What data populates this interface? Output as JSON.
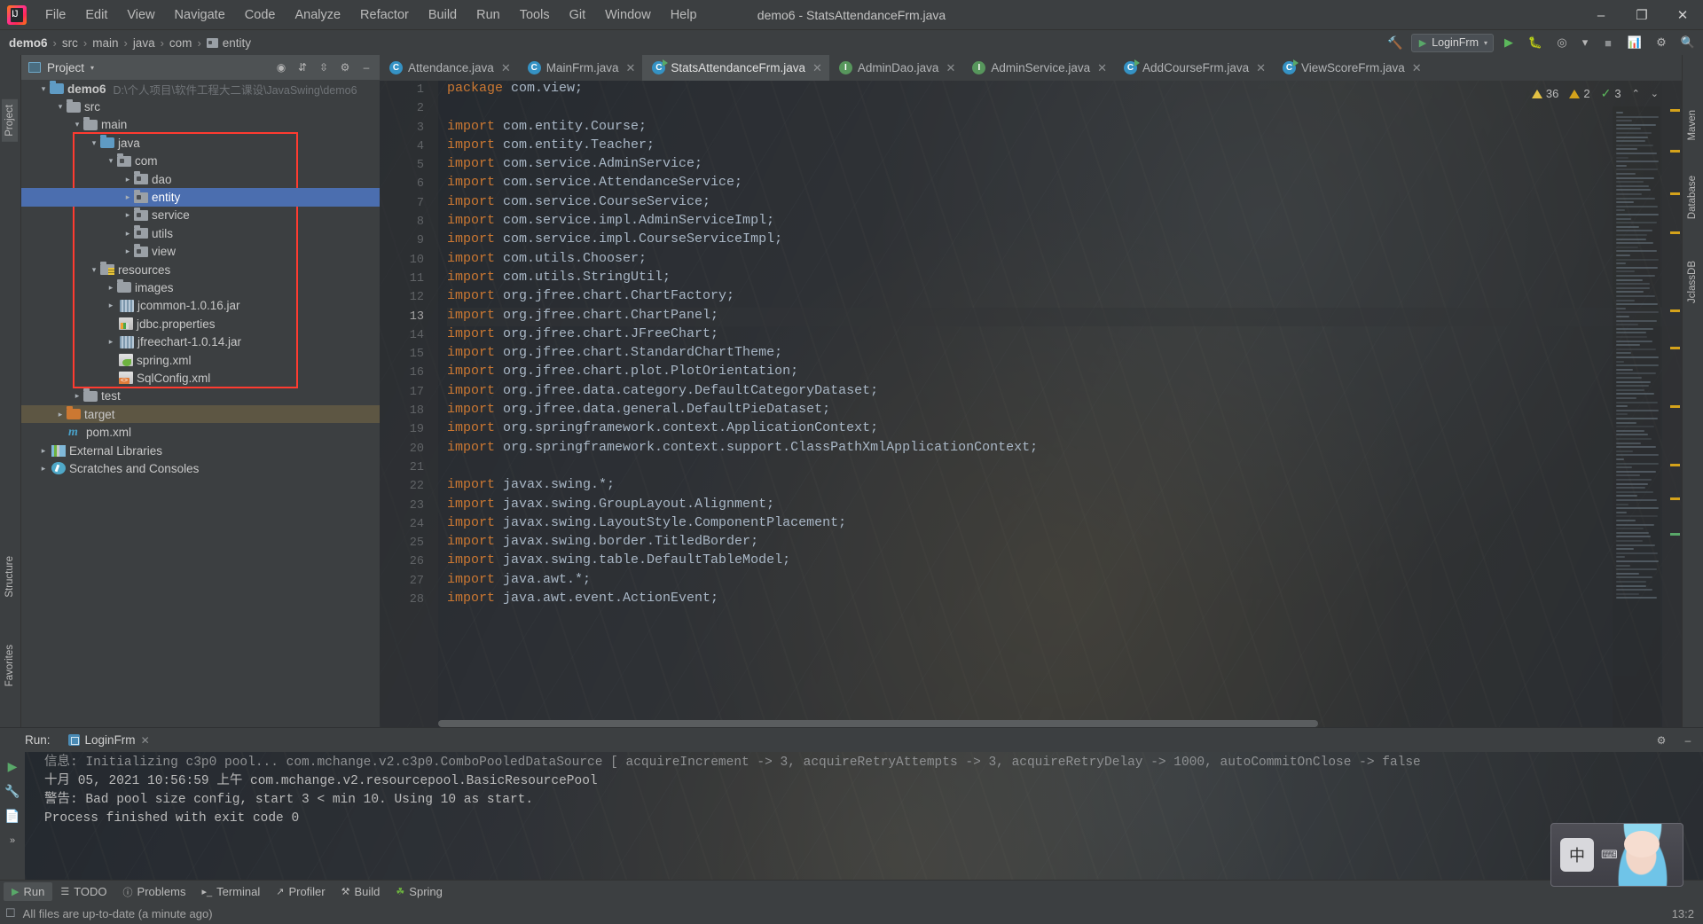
{
  "window": {
    "title": "demo6 - StatsAttendanceFrm.java",
    "controls": {
      "minimize": "–",
      "maximize": "❐",
      "close": "✕"
    }
  },
  "menubar": [
    "File",
    "Edit",
    "View",
    "Navigate",
    "Code",
    "Analyze",
    "Refactor",
    "Build",
    "Run",
    "Tools",
    "Git",
    "Window",
    "Help"
  ],
  "breadcrumb": {
    "items": [
      "demo6",
      "src",
      "main",
      "java",
      "com",
      "entity"
    ],
    "separator": "›"
  },
  "toolbar": {
    "hammer_icon": "hammer-icon",
    "run_config": "LoginFrm",
    "run_config_caret": "▾",
    "run_button": "▶",
    "debug_button": "debug-icon",
    "coverage_button": "coverage-icon",
    "profile_caret": "▾",
    "stop_button": "■",
    "search_button": "search-icon",
    "updates_button": "updates-icon"
  },
  "left_strip": {
    "tabs": [
      "Project",
      "Structure",
      "Favorites"
    ]
  },
  "right_strip": {
    "tabs": [
      "Maven",
      "Database",
      "JclassDB"
    ]
  },
  "project_panel": {
    "title": "Project",
    "caret": "▾",
    "buttons": [
      "locate-icon",
      "expand-all-icon",
      "collapse-all-icon",
      "settings-icon",
      "hide-icon"
    ],
    "tree": [
      {
        "label": "demo6",
        "sub": "D:\\个人项目\\软件工程大二课设\\JavaSwing\\demo6",
        "indent": 0,
        "arrow": "down",
        "icon": "module-folder",
        "bold": true,
        "state": "normal"
      },
      {
        "label": "src",
        "indent": 1,
        "arrow": "down",
        "icon": "folder",
        "state": "normal"
      },
      {
        "label": "main",
        "indent": 2,
        "arrow": "down",
        "icon": "folder",
        "state": "normal"
      },
      {
        "label": "java",
        "indent": 3,
        "arrow": "down",
        "icon": "source-folder",
        "state": "normal"
      },
      {
        "label": "com",
        "indent": 4,
        "arrow": "down",
        "icon": "package",
        "state": "normal"
      },
      {
        "label": "dao",
        "indent": 5,
        "arrow": "right",
        "icon": "package",
        "state": "normal"
      },
      {
        "label": "entity",
        "indent": 5,
        "arrow": "right",
        "icon": "package",
        "state": "selected"
      },
      {
        "label": "service",
        "indent": 5,
        "arrow": "right",
        "icon": "package",
        "state": "normal"
      },
      {
        "label": "utils",
        "indent": 5,
        "arrow": "right",
        "icon": "package",
        "state": "normal"
      },
      {
        "label": "view",
        "indent": 5,
        "arrow": "right",
        "icon": "package",
        "state": "normal"
      },
      {
        "label": "resources",
        "indent": 3,
        "arrow": "down",
        "icon": "resource-folder",
        "state": "normal"
      },
      {
        "label": "images",
        "indent": 4,
        "arrow": "right",
        "icon": "folder",
        "state": "normal"
      },
      {
        "label": "jcommon-1.0.16.jar",
        "indent": 4,
        "arrow": "right",
        "icon": "jar",
        "state": "normal"
      },
      {
        "label": "jdbc.properties",
        "indent": 4,
        "arrow": "none",
        "icon": "properties",
        "state": "normal"
      },
      {
        "label": "jfreechart-1.0.14.jar",
        "indent": 4,
        "arrow": "right",
        "icon": "jar",
        "state": "normal"
      },
      {
        "label": "spring.xml",
        "indent": 4,
        "arrow": "none",
        "icon": "spring-xml",
        "state": "normal"
      },
      {
        "label": "SqlConfig.xml",
        "indent": 4,
        "arrow": "none",
        "icon": "xml",
        "state": "normal"
      },
      {
        "label": "test",
        "indent": 2,
        "arrow": "right",
        "icon": "folder",
        "state": "normal"
      },
      {
        "label": "target",
        "indent": 1,
        "arrow": "right",
        "icon": "target-folder",
        "state": "highlight"
      },
      {
        "label": "pom.xml",
        "indent": 1,
        "arrow": "none",
        "icon": "maven",
        "state": "normal"
      },
      {
        "label": "External Libraries",
        "indent": 0,
        "arrow": "right",
        "icon": "libraries",
        "state": "normal"
      },
      {
        "label": "Scratches and Consoles",
        "indent": 0,
        "arrow": "right",
        "icon": "scratches",
        "state": "normal"
      }
    ]
  },
  "editor": {
    "tabs": [
      {
        "label": "Attendance.java",
        "icon": "class-icon",
        "active": false,
        "close": "✕"
      },
      {
        "label": "MainFrm.java",
        "icon": "class-icon",
        "active": false,
        "close": "✕"
      },
      {
        "label": "StatsAttendanceFrm.java",
        "icon": "runnable-class-icon",
        "active": true,
        "close": "✕"
      },
      {
        "label": "AdminDao.java",
        "icon": "interface-icon",
        "active": false,
        "close": "✕"
      },
      {
        "label": "AdminService.java",
        "icon": "interface-icon",
        "active": false,
        "close": "✕"
      },
      {
        "label": "AddCourseFrm.java",
        "icon": "runnable-class-icon",
        "active": false,
        "close": "✕"
      },
      {
        "label": "ViewScoreFrm.java",
        "icon": "runnable-class-icon",
        "active": false,
        "close": "✕"
      }
    ],
    "inspection": {
      "warnings": "36",
      "weak_warnings": "2",
      "ok_marks": "3",
      "up_caret": "⌃",
      "down_caret": "⌄"
    },
    "current_line": 13,
    "lines": [
      {
        "n": 1,
        "kw": "package",
        "rest": " com.view;"
      },
      {
        "n": 2,
        "kw": "",
        "rest": ""
      },
      {
        "n": 3,
        "kw": "import",
        "rest": " com.entity.Course;",
        "fold": true
      },
      {
        "n": 4,
        "kw": "import",
        "rest": " com.entity.Teacher;"
      },
      {
        "n": 5,
        "kw": "import",
        "rest": " com.service.AdminService;"
      },
      {
        "n": 6,
        "kw": "import",
        "rest": " com.service.AttendanceService;"
      },
      {
        "n": 7,
        "kw": "import",
        "rest": " com.service.CourseService;"
      },
      {
        "n": 8,
        "kw": "import",
        "rest": " com.service.impl.AdminServiceImpl;"
      },
      {
        "n": 9,
        "kw": "import",
        "rest": " com.service.impl.CourseServiceImpl;"
      },
      {
        "n": 10,
        "kw": "import",
        "rest": " com.utils.Chooser;"
      },
      {
        "n": 11,
        "kw": "import",
        "rest": " com.utils.StringUtil;"
      },
      {
        "n": 12,
        "kw": "import",
        "rest": " org.jfree.chart.ChartFactory;"
      },
      {
        "n": 13,
        "kw": "import",
        "rest": " org.jfree.chart.ChartPanel;"
      },
      {
        "n": 14,
        "kw": "import",
        "rest": " org.jfree.chart.JFreeChart;"
      },
      {
        "n": 15,
        "kw": "import",
        "rest": " org.jfree.chart.StandardChartTheme;"
      },
      {
        "n": 16,
        "kw": "import",
        "rest": " org.jfree.chart.plot.PlotOrientation;"
      },
      {
        "n": 17,
        "kw": "import",
        "rest": " org.jfree.data.category.DefaultCategoryDataset;"
      },
      {
        "n": 18,
        "kw": "import",
        "rest": " org.jfree.data.general.DefaultPieDataset;"
      },
      {
        "n": 19,
        "kw": "import",
        "rest": " org.springframework.context.ApplicationContext;"
      },
      {
        "n": 20,
        "kw": "import",
        "rest": " org.springframework.context.support.ClassPathXmlApplicationContext;"
      },
      {
        "n": 21,
        "kw": "",
        "rest": ""
      },
      {
        "n": 22,
        "kw": "import",
        "rest": " javax.swing.*;"
      },
      {
        "n": 23,
        "kw": "import",
        "rest": " javax.swing.GroupLayout.Alignment;"
      },
      {
        "n": 24,
        "kw": "import",
        "rest": " javax.swing.LayoutStyle.ComponentPlacement;"
      },
      {
        "n": 25,
        "kw": "import",
        "rest": " javax.swing.border.TitledBorder;"
      },
      {
        "n": 26,
        "kw": "import",
        "rest": " javax.swing.table.DefaultTableModel;"
      },
      {
        "n": 27,
        "kw": "import",
        "rest": " java.awt.*;"
      },
      {
        "n": 28,
        "kw": "import",
        "rest": " java.awt.event.ActionEvent;"
      }
    ]
  },
  "run_panel": {
    "label": "Run:",
    "tab": "LoginFrm",
    "tab_close": "✕",
    "settings_icon": "gear-icon",
    "hide_icon": "–",
    "side_buttons": [
      "rerun-icon",
      "settings-icon",
      "print-icon"
    ],
    "console": [
      "信息: Initializing c3p0 pool... com.mchange.v2.c3p0.ComboPooledDataSource [ acquireIncrement -> 3, acquireRetryAttempts -> 3, acquireRetryDelay -> 1000, autoCommitOnClose -> false",
      "十月 05, 2021 10:56:59 上午 com.mchange.v2.resourcepool.BasicResourcePool",
      "警告: Bad pool size config, start 3 < min 10. Using 10 as start.",
      "",
      "Process finished with exit code 0"
    ]
  },
  "bottom_bar": {
    "items": [
      {
        "label": "Run",
        "icon": "▶",
        "selected": true
      },
      {
        "label": "TODO",
        "icon": "todo-icon",
        "selected": false
      },
      {
        "label": "Problems",
        "icon": "problems-icon",
        "selected": false
      },
      {
        "label": "Terminal",
        "icon": "terminal-icon",
        "selected": false
      },
      {
        "label": "Profiler",
        "icon": "profiler-icon",
        "selected": false
      },
      {
        "label": "Build",
        "icon": "build-icon",
        "selected": false
      },
      {
        "label": "Spring",
        "icon": "spring-icon",
        "selected": false
      }
    ]
  },
  "status_bar": {
    "message": "All files are up-to-date (a minute ago)",
    "caret_position": "13:2",
    "event_icon": "event-log-icon"
  },
  "ime_widget": {
    "mode": "中",
    "tools": [
      "⌨",
      "✿"
    ]
  }
}
